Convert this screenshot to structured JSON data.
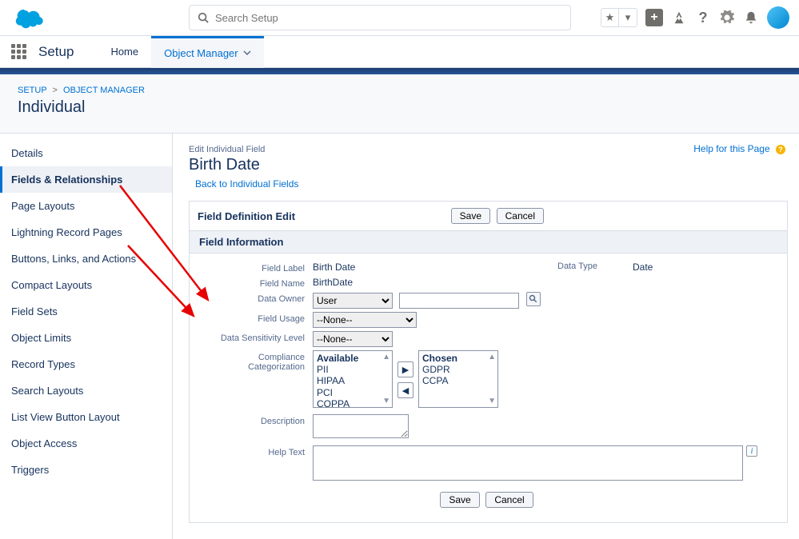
{
  "header": {
    "search_placeholder": "Search Setup"
  },
  "nav": {
    "app_title": "Setup",
    "tabs": [
      "Home",
      "Object Manager"
    ]
  },
  "breadcrumb": {
    "setup": "SETUP",
    "obj_mgr": "OBJECT MANAGER",
    "page_title": "Individual"
  },
  "sidebar": {
    "items": [
      "Details",
      "Fields & Relationships",
      "Page Layouts",
      "Lightning Record Pages",
      "Buttons, Links, and Actions",
      "Compact Layouts",
      "Field Sets",
      "Object Limits",
      "Record Types",
      "Search Layouts",
      "List View Button Layout",
      "Object Access",
      "Triggers"
    ],
    "active_index": 1
  },
  "content": {
    "edit_crumb": "Edit Individual Field",
    "title": "Birth Date",
    "back_link": "Back to Individual Fields",
    "help_link": "Help for this Page"
  },
  "panel": {
    "title": "Field Definition Edit",
    "subtitle": "Field Information",
    "save": "Save",
    "cancel": "Cancel"
  },
  "form": {
    "field_label_lbl": "Field Label",
    "field_label_val": "Birth Date",
    "field_name_lbl": "Field Name",
    "field_name_val": "BirthDate",
    "data_owner_lbl": "Data Owner",
    "data_owner_sel": "User",
    "field_usage_lbl": "Field Usage",
    "field_usage_sel": "--None--",
    "sensitivity_lbl": "Data Sensitivity Level",
    "sensitivity_sel": "--None--",
    "compliance_lbl": "Compliance Categorization",
    "available_title": "Available",
    "available_items": [
      "PII",
      "HIPAA",
      "PCI",
      "COPPA"
    ],
    "chosen_title": "Chosen",
    "chosen_items": [
      "GDPR",
      "CCPA"
    ],
    "description_lbl": "Description",
    "help_text_lbl": "Help Text",
    "data_type_lbl": "Data Type",
    "data_type_val": "Date"
  }
}
